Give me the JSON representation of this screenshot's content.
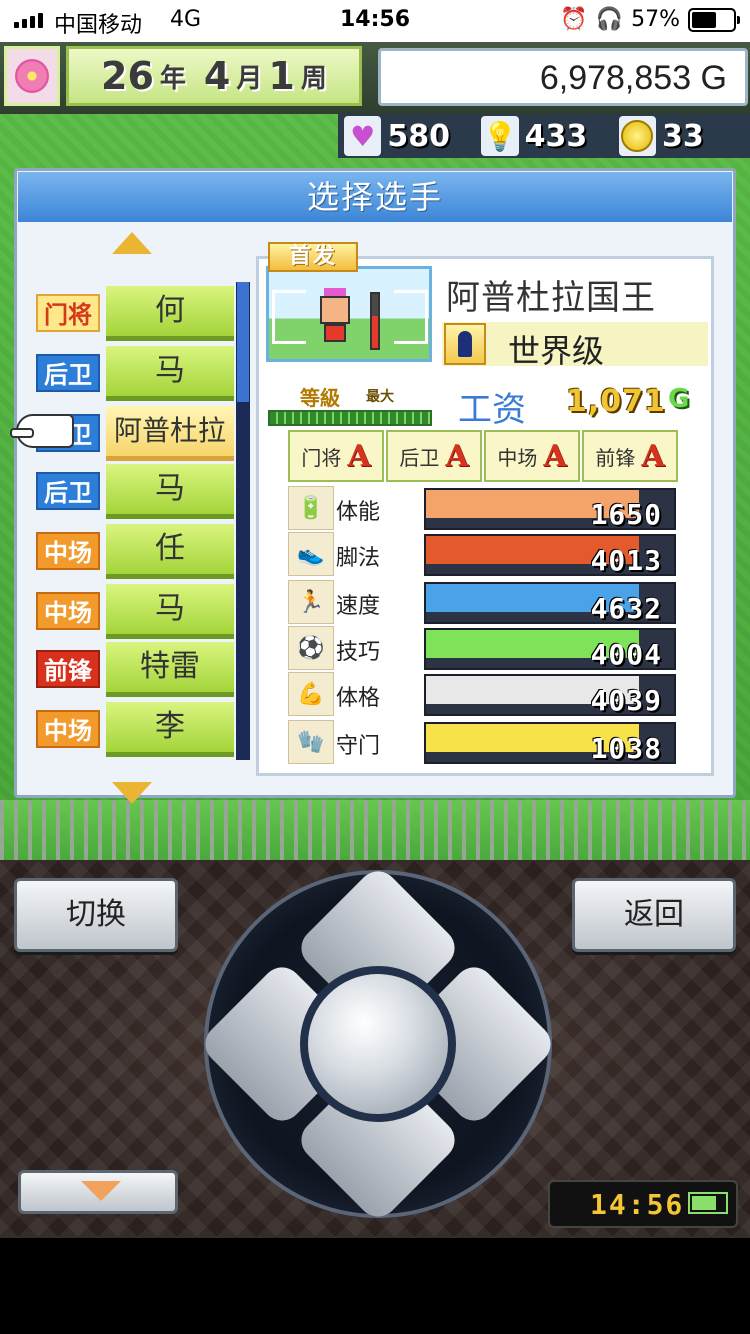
{
  "status_bar": {
    "carrier": "中国移动",
    "network": "4G",
    "time": "14:56",
    "battery": "57%"
  },
  "hud": {
    "year": "26",
    "year_unit": "年",
    "month": "4",
    "month_unit": "月",
    "week": "1",
    "week_unit": "周",
    "money": "6,978,853 G",
    "resources": [
      {
        "icon": "heart-icon",
        "value": "580"
      },
      {
        "icon": "bulb-icon",
        "value": "433"
      },
      {
        "icon": "coin-icon",
        "value": "33"
      }
    ]
  },
  "dialog": {
    "title": "选择选手"
  },
  "players": [
    {
      "pos": "门将",
      "type": "gk",
      "name": "何"
    },
    {
      "pos": "后卫",
      "type": "df",
      "name": "马"
    },
    {
      "pos": "后卫",
      "type": "df",
      "name": "阿普杜拉",
      "selected": true
    },
    {
      "pos": "后卫",
      "type": "df",
      "name": "马"
    },
    {
      "pos": "中场",
      "type": "mf",
      "name": "任"
    },
    {
      "pos": "中场",
      "type": "mf",
      "name": "马"
    },
    {
      "pos": "前锋",
      "type": "fw",
      "name": "特雷"
    },
    {
      "pos": "中场",
      "type": "mf",
      "name": "李"
    }
  ],
  "detail": {
    "tag": "首发",
    "full_name": "阿普杜拉国王",
    "rank": "世界级",
    "level_label": "等級",
    "level_max": "最大",
    "salary_label": "工资",
    "salary_value": "1,071",
    "salary_unit": "G",
    "aptitudes": [
      {
        "label": "门将",
        "grade": "A"
      },
      {
        "label": "后卫",
        "grade": "A"
      },
      {
        "label": "中场",
        "grade": "A"
      },
      {
        "label": "前锋",
        "grade": "A"
      }
    ],
    "stats": [
      {
        "label": "体能",
        "value": "1650",
        "fill": 0.86,
        "color": "#f4a36a",
        "icon": "stamina-icon"
      },
      {
        "label": "脚法",
        "value": "4013",
        "fill": 0.86,
        "color": "#e45a2c",
        "icon": "kick-icon"
      },
      {
        "label": "速度",
        "value": "4632",
        "fill": 0.86,
        "color": "#4aa3e8",
        "icon": "speed-icon"
      },
      {
        "label": "技巧",
        "value": "4004",
        "fill": 0.86,
        "color": "#7fe35a",
        "icon": "skill-icon"
      },
      {
        "label": "体格",
        "value": "4039",
        "fill": 0.86,
        "color": "#e8e8e8",
        "icon": "physique-icon"
      },
      {
        "label": "守门",
        "value": "1038",
        "fill": 0.86,
        "color": "#f7e24a",
        "icon": "goalkeeping-icon"
      }
    ]
  },
  "controls": {
    "switch_label": "切换",
    "back_label": "返回",
    "clock": "14:56"
  }
}
